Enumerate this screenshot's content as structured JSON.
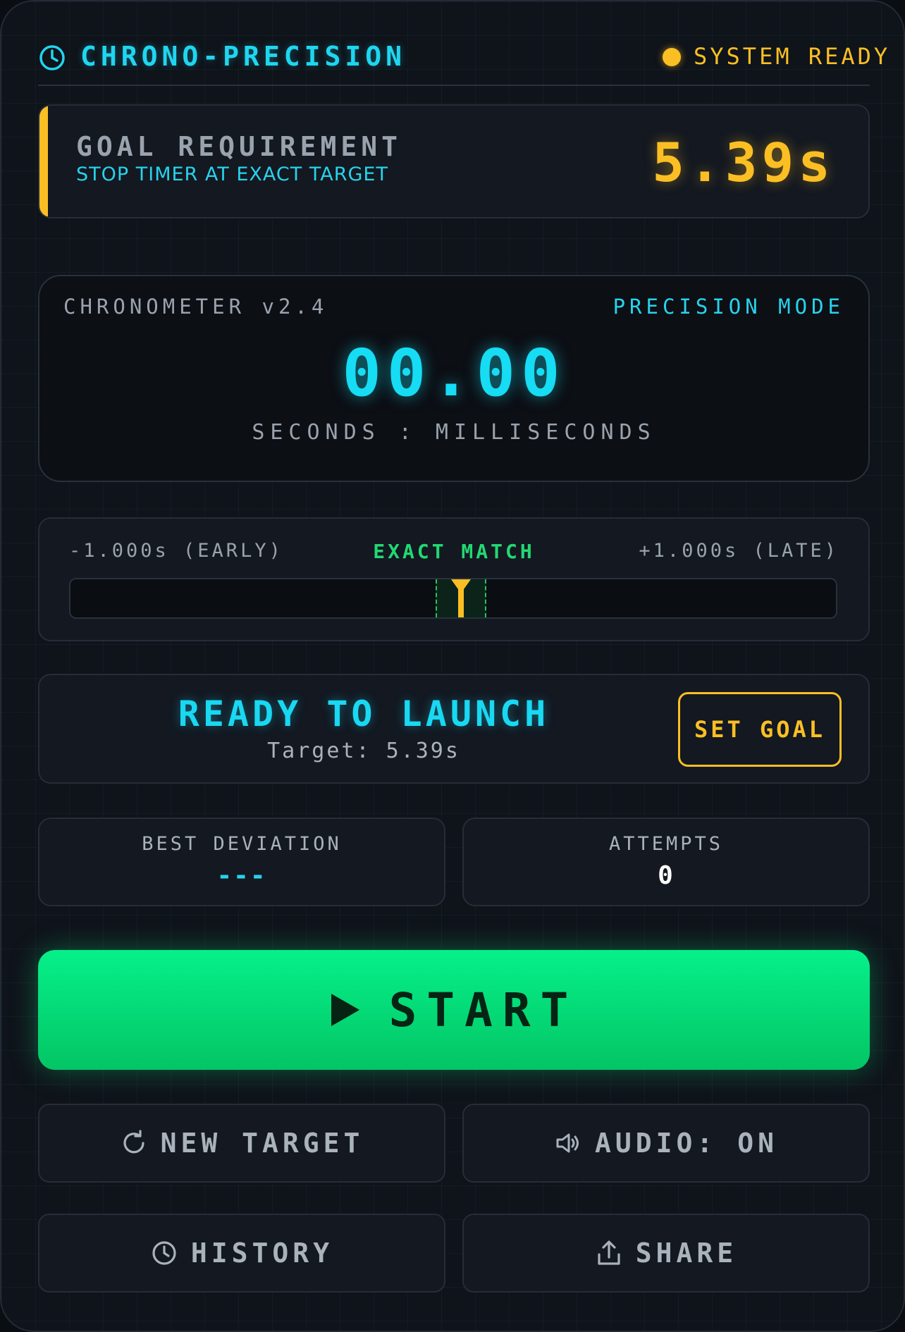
{
  "header": {
    "app_title": "CHRONO-PRECISION",
    "status": "SYSTEM READY",
    "accent": "#1fd6f0",
    "status_color": "#fbbf24"
  },
  "goal": {
    "title": "GOAL REQUIREMENT",
    "subtitle": "STOP TIMER AT EXACT TARGET",
    "value": "5.39s"
  },
  "chronometer": {
    "label": "CHRONOMETER v2.4",
    "mode": "PRECISION MODE",
    "time": "00.00",
    "units": "SECONDS : MILLISECONDS"
  },
  "meter": {
    "early_label": "-1.000s (EARLY)",
    "exact_label": "EXACT MATCH",
    "late_label": "+1.000s (LATE)",
    "deviation": 0
  },
  "ready": {
    "title": "READY TO LAUNCH",
    "subtitle": "Target: 5.39s",
    "set_goal_label": "SET GOAL"
  },
  "stats": {
    "best_label": "BEST DEVIATION",
    "best_value": "---",
    "attempts_label": "ATTEMPTS",
    "attempts_value": "0"
  },
  "actions": {
    "start_label": "START",
    "new_target_label": "NEW TARGET",
    "audio_label": "AUDIO: ON",
    "history_label": "HISTORY",
    "share_label": "SHARE"
  },
  "icons": {
    "header": "clock-icon",
    "start": "play-icon",
    "new_target": "refresh-icon",
    "audio": "speaker-icon",
    "history": "clock-icon",
    "share": "share-icon"
  }
}
